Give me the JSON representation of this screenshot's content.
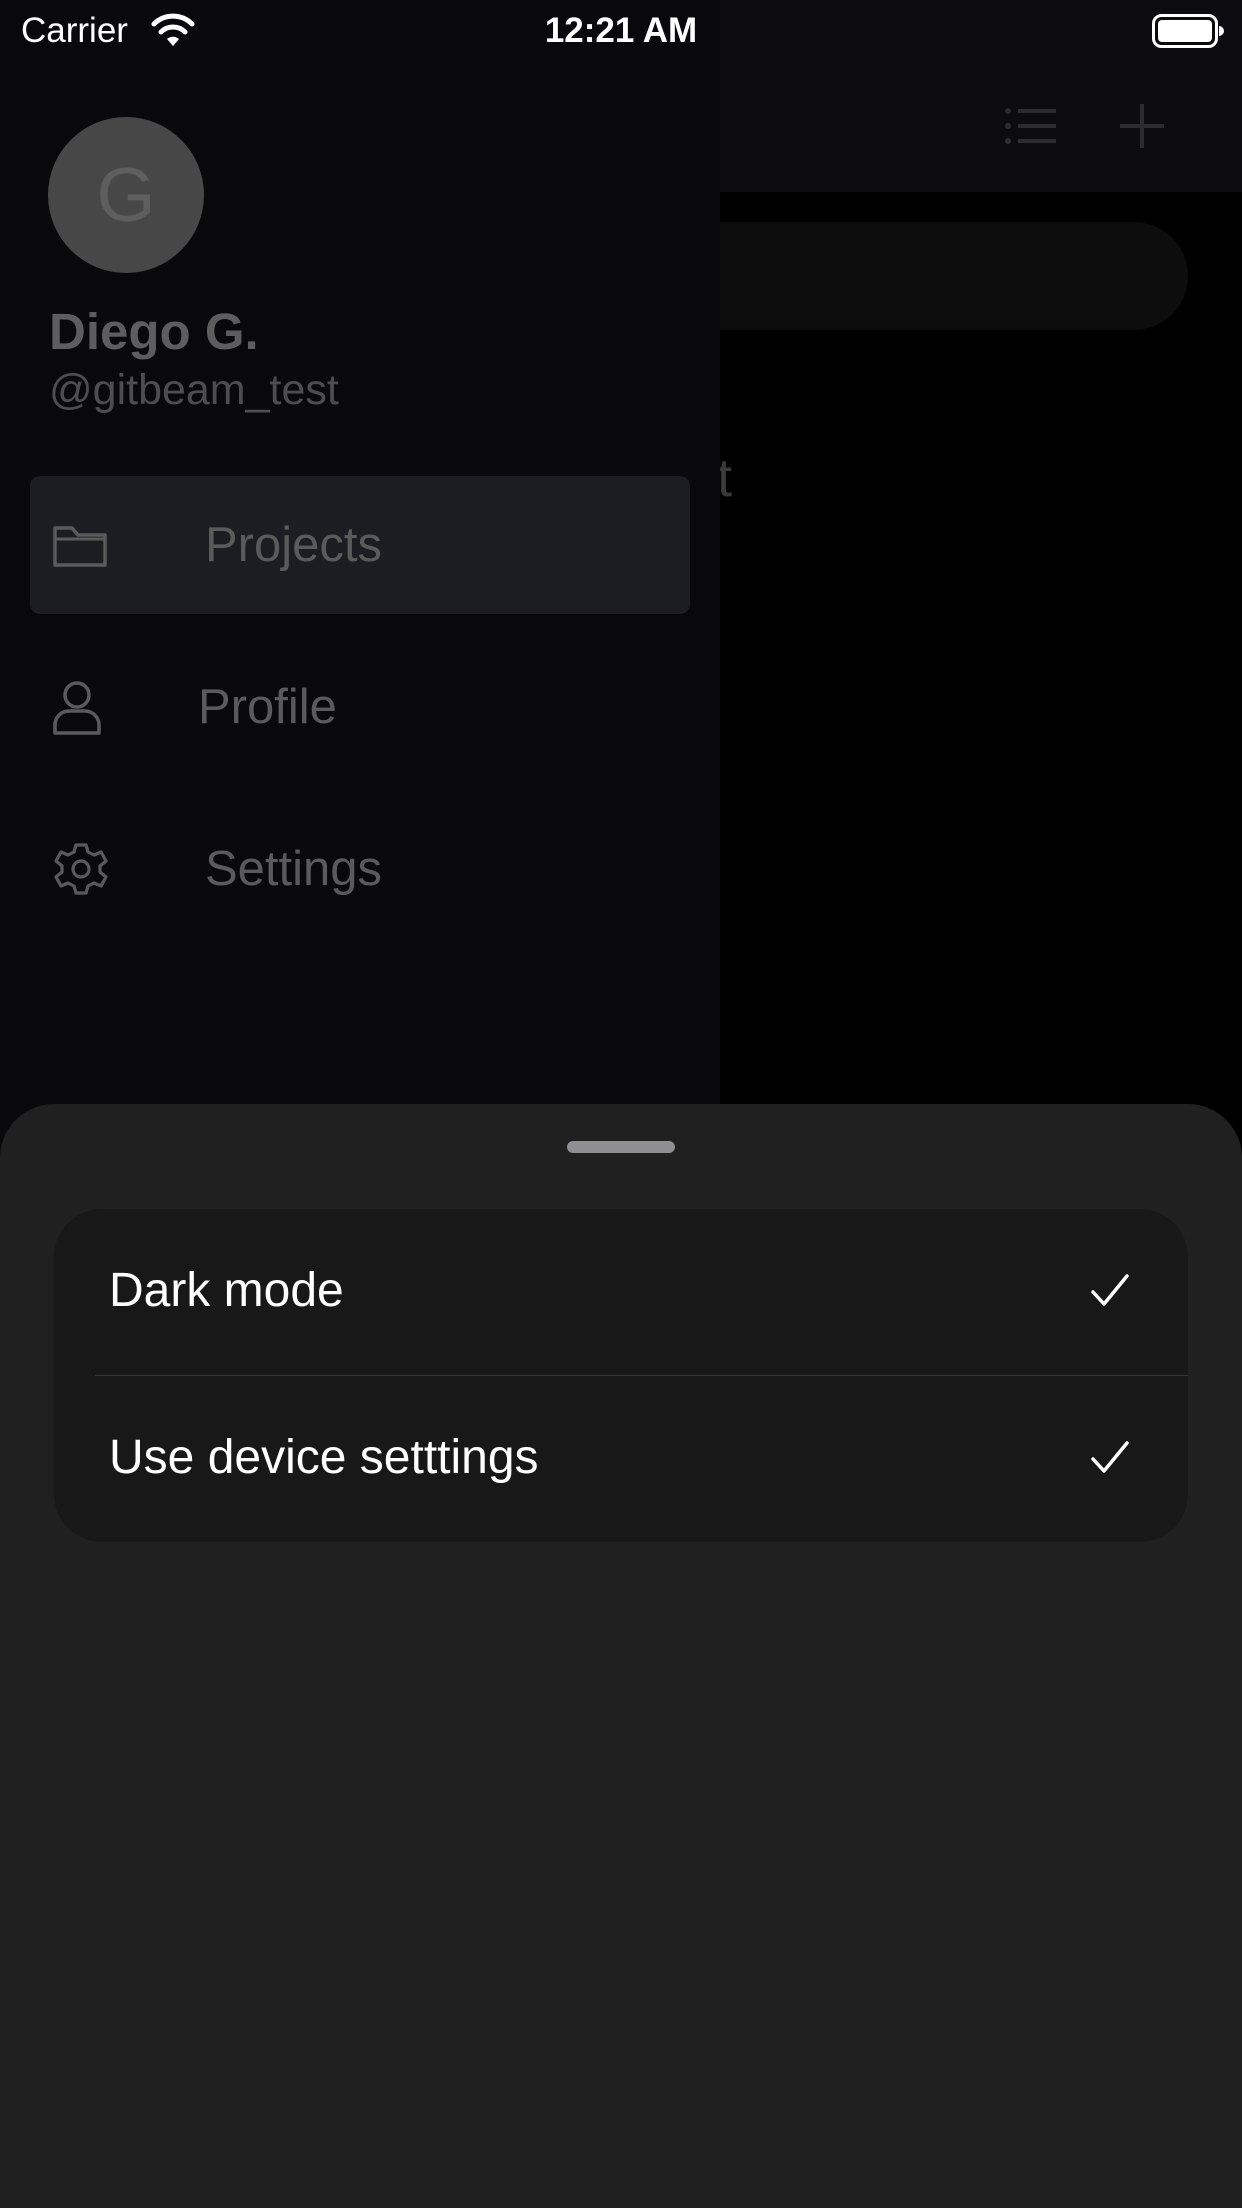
{
  "status_bar": {
    "carrier": "Carrier",
    "time": "12:21 AM",
    "icons": [
      "wifi-icon",
      "battery-icon"
    ]
  },
  "main": {
    "nav_icons": [
      "list-icon",
      "add-icon"
    ],
    "title_fragment": "ct"
  },
  "drawer": {
    "avatar_initial": "G",
    "user_name": "Diego G.",
    "user_handle": "@gitbeam_test",
    "items": [
      {
        "label": "Projects",
        "icon": "folder-icon",
        "active": true
      },
      {
        "label": "Profile",
        "icon": "person-icon",
        "active": false
      },
      {
        "label": "Settings",
        "icon": "gear-icon",
        "active": false
      }
    ]
  },
  "sheet": {
    "options": [
      {
        "label": "Dark mode",
        "checked": true
      },
      {
        "label": "Use device setttings",
        "checked": true
      }
    ]
  },
  "colors": {
    "sheet_background": "#202020",
    "card_background": "#181818",
    "drawer_background": "#09090b",
    "active_item_background": "#1c1d22",
    "text_primary": "#ffffff"
  }
}
